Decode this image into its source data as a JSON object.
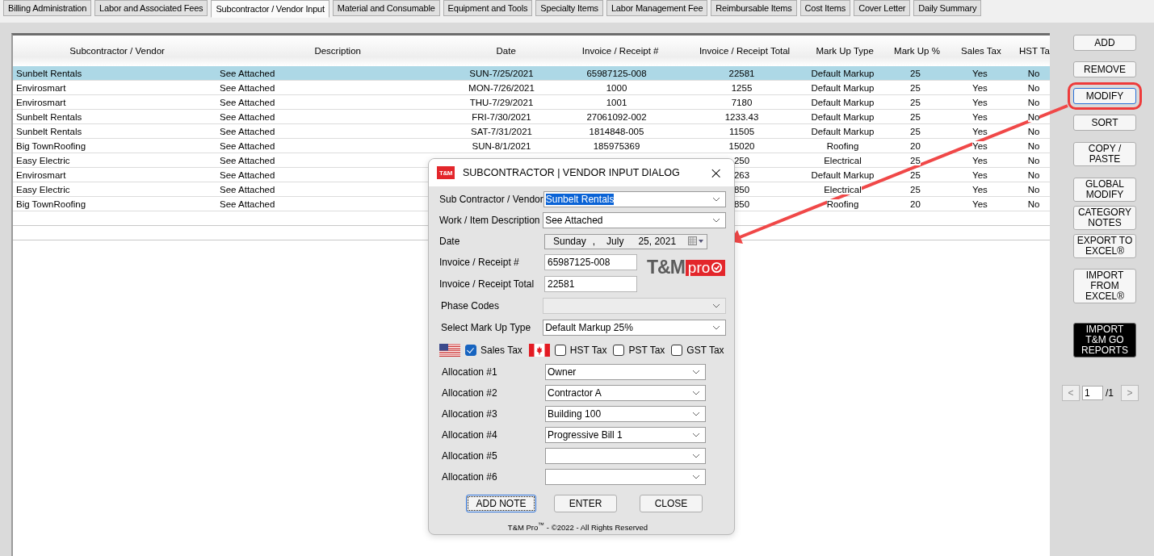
{
  "tabs": [
    {
      "label": "Billing Administration",
      "selected": false
    },
    {
      "label": "Labor and Associated Fees",
      "selected": false
    },
    {
      "label": "Subcontractor / Vendor Input",
      "selected": true
    },
    {
      "label": "Material and Consumable",
      "selected": false
    },
    {
      "label": "Equipment and Tools",
      "selected": false
    },
    {
      "label": "Specialty Items",
      "selected": false
    },
    {
      "label": "Labor Management Fee",
      "selected": false
    },
    {
      "label": "Reimbursable Items",
      "selected": false
    },
    {
      "label": "Cost Items",
      "selected": false
    },
    {
      "label": "Cover Letter",
      "selected": false
    },
    {
      "label": "Daily Summary",
      "selected": false
    }
  ],
  "table": {
    "columns": [
      "Subcontractor / Vendor",
      "Description",
      "Date",
      "Invoice / Receipt #",
      "Invoice / Receipt Total",
      "Mark Up Type",
      "Mark Up %",
      "Sales Tax",
      "HST Ta"
    ],
    "rows": [
      {
        "selected": true,
        "cells": [
          "Sunbelt Rentals",
          "See Attached",
          "SUN-7/25/2021",
          "65987125-008",
          "22581",
          "Default Markup",
          "25",
          "Yes",
          "No"
        ]
      },
      {
        "selected": false,
        "cells": [
          "Envirosmart",
          "See Attached",
          "MON-7/26/2021",
          "1000",
          "1255",
          "Default Markup",
          "25",
          "Yes",
          "No"
        ]
      },
      {
        "selected": false,
        "cells": [
          "Envirosmart",
          "See Attached",
          "THU-7/29/2021",
          "1001",
          "7180",
          "Default Markup",
          "25",
          "Yes",
          "No"
        ]
      },
      {
        "selected": false,
        "cells": [
          "Sunbelt Rentals",
          "See Attached",
          "FRI-7/30/2021",
          "27061092-002",
          "1233.43",
          "Default Markup",
          "25",
          "Yes",
          "No"
        ]
      },
      {
        "selected": false,
        "cells": [
          "Sunbelt Rentals",
          "See Attached",
          "SAT-7/31/2021",
          "1814848-005",
          "11505",
          "Default Markup",
          "25",
          "Yes",
          "No"
        ]
      },
      {
        "selected": false,
        "cells": [
          "Big TownRoofing",
          "See Attached",
          "SUN-8/1/2021",
          "185975369",
          "15020",
          "Roofing",
          "20",
          "Yes",
          "No"
        ]
      },
      {
        "selected": false,
        "cells": [
          "Easy Electric",
          "See Attached",
          "",
          "",
          "250",
          "Electrical",
          "25",
          "Yes",
          "No"
        ]
      },
      {
        "selected": false,
        "cells": [
          "Envirosmart",
          "See Attached",
          "",
          "",
          "263",
          "Default Markup",
          "25",
          "Yes",
          "No"
        ]
      },
      {
        "selected": false,
        "cells": [
          "Easy Electric",
          "See Attached",
          "",
          "",
          "850",
          "Electrical",
          "25",
          "Yes",
          "No"
        ]
      },
      {
        "selected": false,
        "cells": [
          "Big TownRoofing",
          "See Attached",
          "",
          "",
          "850",
          "Roofing",
          "20",
          "Yes",
          "No"
        ]
      }
    ]
  },
  "side_buttons": [
    {
      "label": "ADD",
      "kind": "normal",
      "highlighted": false
    },
    {
      "label": "REMOVE",
      "kind": "normal",
      "highlighted": false
    },
    {
      "label": "MODIFY",
      "kind": "normal",
      "highlighted": true
    },
    {
      "label": "SORT",
      "kind": "normal",
      "highlighted": false
    },
    {
      "label": "COPY /\nPASTE",
      "kind": "normal",
      "highlighted": false
    },
    {
      "label": "GLOBAL\nMODIFY",
      "kind": "normal",
      "highlighted": false
    },
    {
      "label": "CATEGORY\nNOTES",
      "kind": "normal",
      "highlighted": false
    },
    {
      "label": "EXPORT TO\nEXCEL®",
      "kind": "normal",
      "highlighted": false
    },
    {
      "label": "IMPORT\nFROM\nEXCEL®",
      "kind": "normal",
      "highlighted": false
    },
    {
      "label": "IMPORT\nT&M GO\nREPORTS",
      "kind": "dark",
      "highlighted": false
    }
  ],
  "pager": {
    "prev": "<",
    "page": "1",
    "total": "/1",
    "next": ">"
  },
  "dialog": {
    "icon_text": "T&M",
    "title": "SUBCONTRACTOR | VENDOR INPUT DIALOG",
    "close": "×",
    "fields": [
      {
        "label": "Sub Contractor / Vendor",
        "kind": "combo",
        "value": "Sunbelt Rentals",
        "text_selected": true,
        "disabled": false
      },
      {
        "label": "Work / Item Description",
        "kind": "combo",
        "value": "See Attached",
        "text_selected": false,
        "disabled": false
      },
      {
        "label": "Date",
        "kind": "date",
        "parts": [
          "Sunday",
          ",",
          "July",
          "25, 2021"
        ]
      },
      {
        "label": "Invoice / Receipt #",
        "kind": "text",
        "value": "65987125-008"
      },
      {
        "label": "Invoice / Receipt Total",
        "kind": "text",
        "value": "22581"
      }
    ],
    "logo": {
      "main": "T&M",
      "accent": "pro"
    },
    "fields2": [
      {
        "label": "Phase Codes",
        "disabled": true
      },
      {
        "label": "Select Mark Up Type",
        "value": "Default Markup 25%",
        "disabled": false
      }
    ],
    "taxes": [
      {
        "kind": "us_flag"
      },
      {
        "kind": "checkbox",
        "label": "Sales Tax",
        "checked": true
      },
      {
        "kind": "ca_flag"
      },
      {
        "kind": "checkbox",
        "label": "HST Tax",
        "checked": false
      },
      {
        "kind": "checkbox",
        "label": "PST Tax",
        "checked": false
      },
      {
        "kind": "checkbox",
        "label": "GST Tax",
        "checked": false
      }
    ],
    "allocations": [
      {
        "label": "Allocation #1",
        "value": "Owner"
      },
      {
        "label": "Allocation #2",
        "value": "Contractor A"
      },
      {
        "label": "Allocation #3",
        "value": "Building 100"
      },
      {
        "label": "Allocation #4",
        "value": "Progressive Bill 1"
      },
      {
        "label": "Allocation #5"
      },
      {
        "label": "Allocation #6"
      }
    ],
    "buttons": [
      {
        "label": "ADD NOTE",
        "focused": true
      },
      {
        "label": "ENTER",
        "focused": false
      },
      {
        "label": "CLOSE",
        "focused": false
      }
    ],
    "footer": "T&M Pro$^{™}$ - ©2022 - All Rights Reserved"
  }
}
